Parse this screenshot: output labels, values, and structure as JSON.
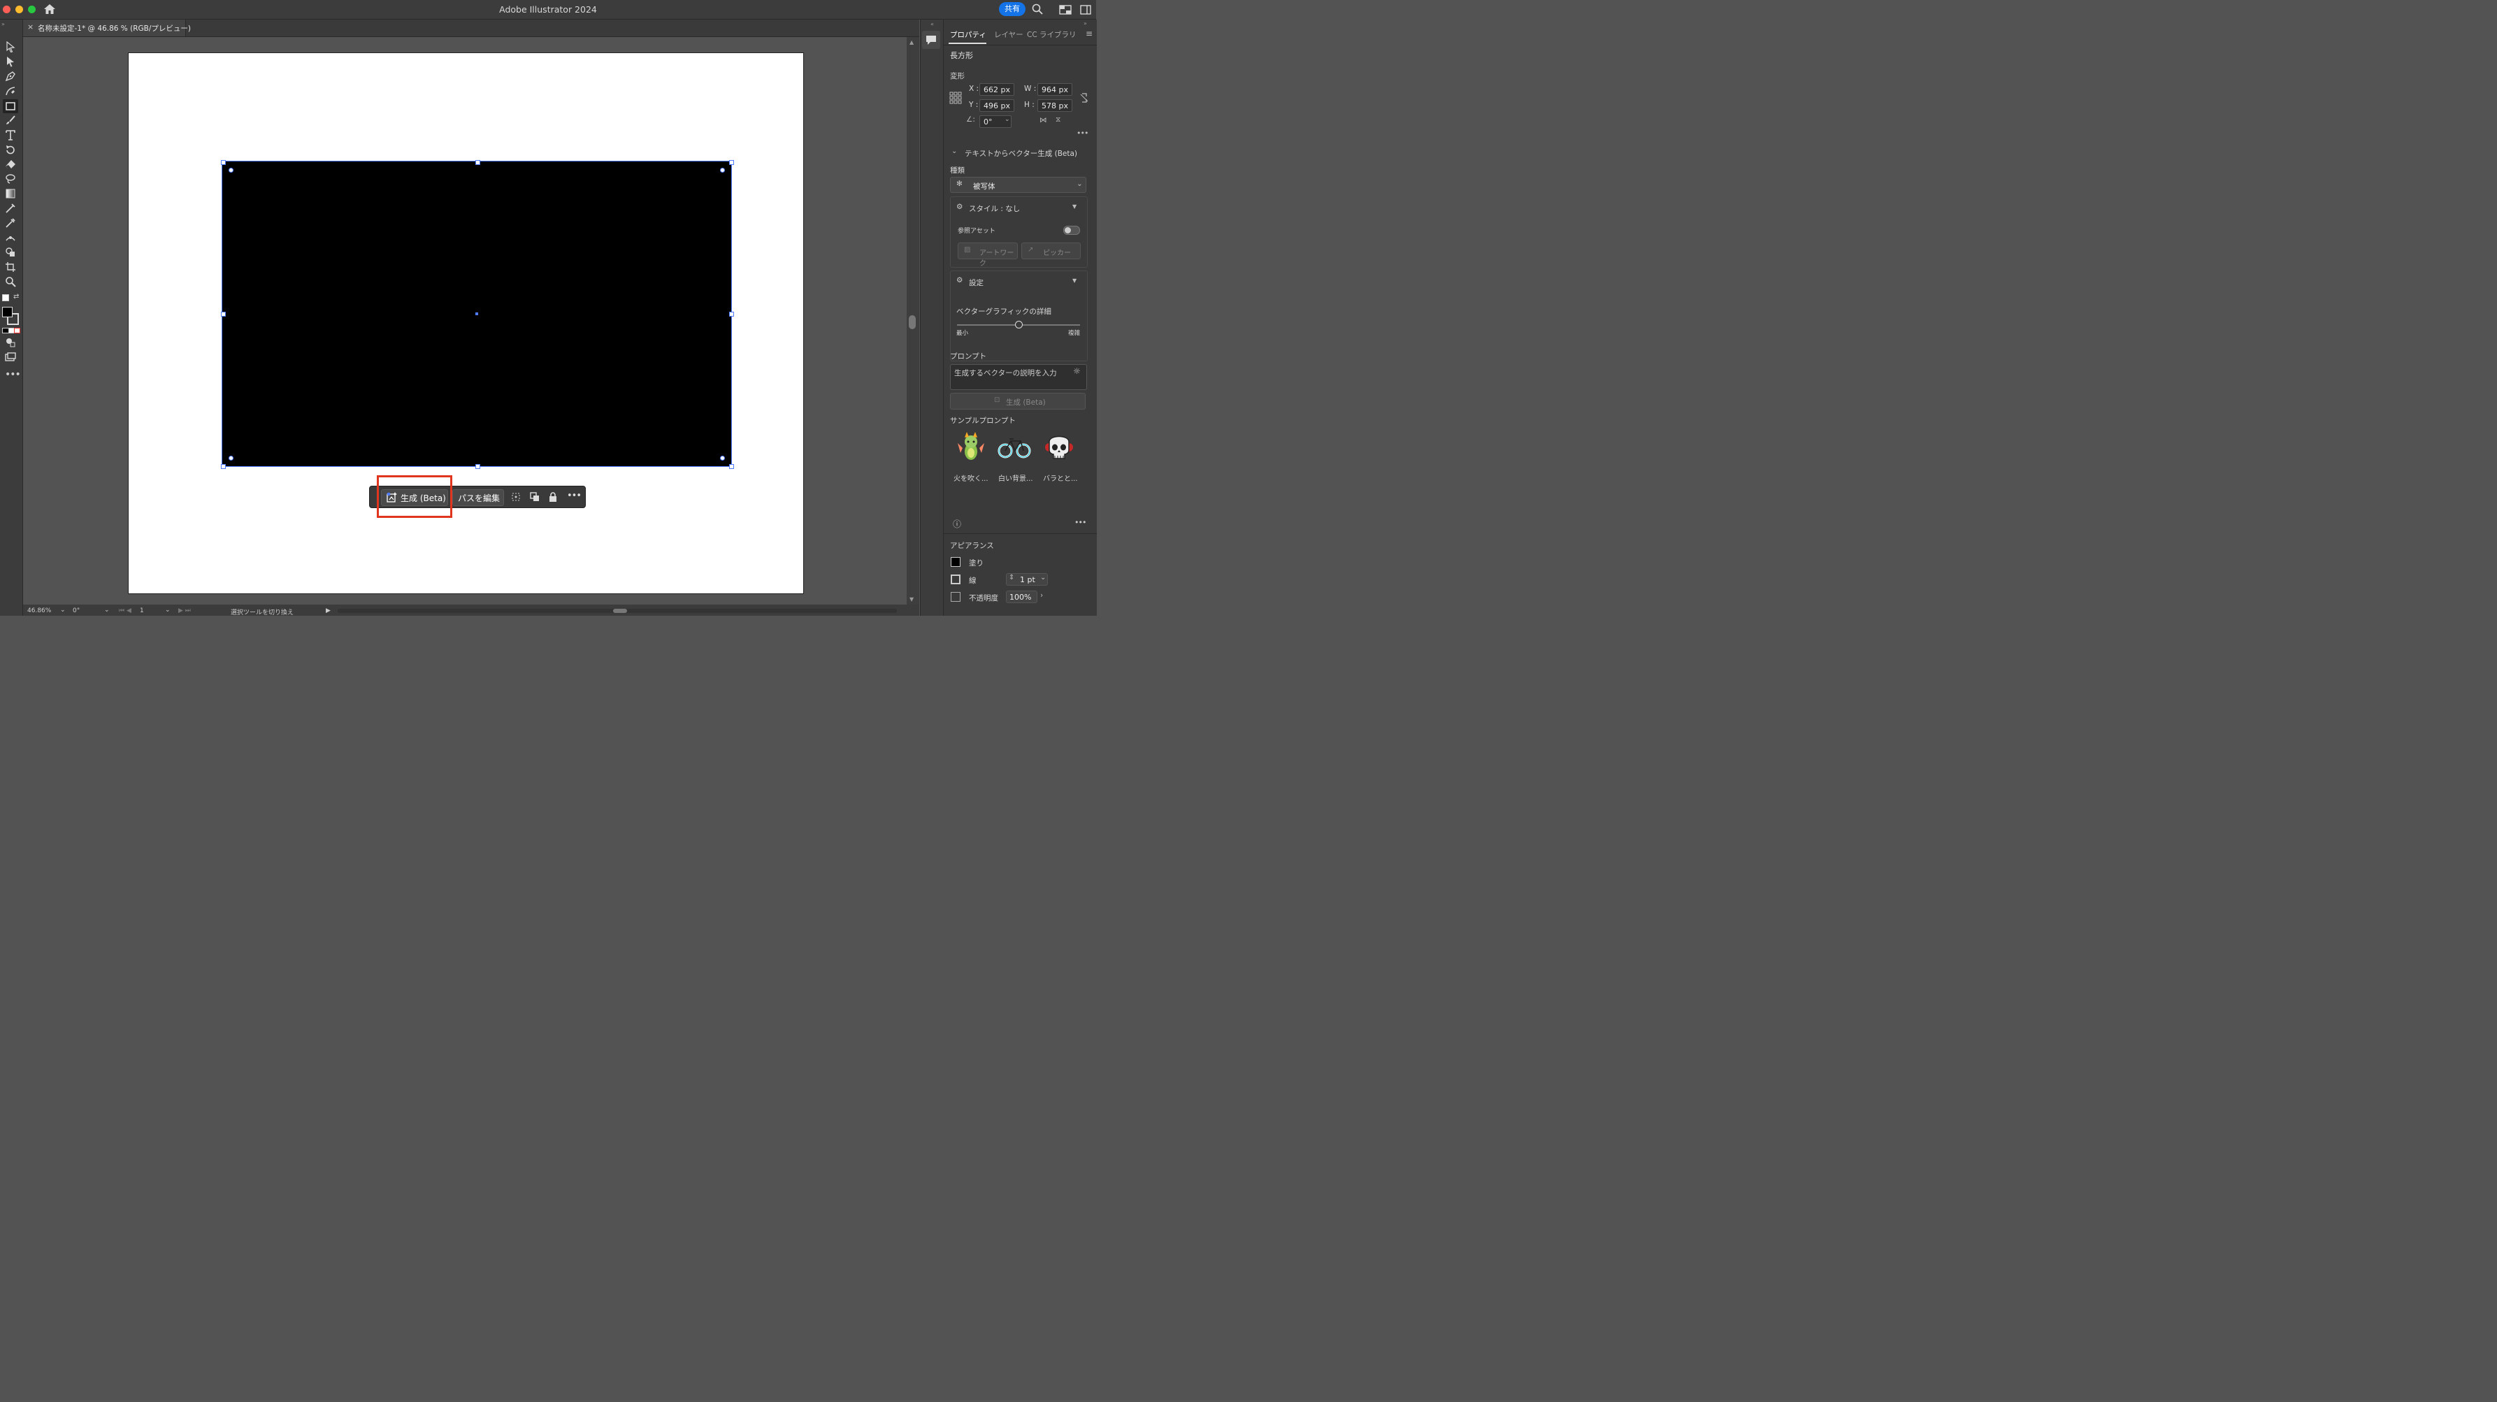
{
  "window": {
    "title": "Adobe Illustrator 2024",
    "share_label": "共有",
    "colors": {
      "close": "#ff5f57",
      "minimize": "#febc2e",
      "zoom": "#28c840",
      "accent": "#1473e6",
      "highlight": "#e0351f"
    }
  },
  "document_tab": {
    "close_glyph": "×",
    "title": "名称未設定-1* @ 46.86 % (RGB/プレビュー)"
  },
  "toolbar": {
    "tools": [
      "selection-tool",
      "direct-selection-tool",
      "pen-tool",
      "curvature-tool",
      "rectangle-tool",
      "paintbrush-tool",
      "type-tool",
      "rotate-tool",
      "eraser-tool",
      "lasso-tool",
      "gradient-tool",
      "eyedropper-tool",
      "width-tool",
      "shape-builder-tool",
      "artboard-tool",
      "zoom-tool"
    ],
    "active_tool": "rectangle-tool",
    "fill_color": "#000000"
  },
  "contextual_taskbar": {
    "generate_label": "生成 (Beta)",
    "edit_path_label": "パスを編集"
  },
  "status": {
    "zoom": "46.86%",
    "rotation": "0°",
    "artboard": "1",
    "hint": "選択ツールを切り換え"
  },
  "panel": {
    "tabs": [
      "プロパティ",
      "レイヤー",
      "CC ライブラリ"
    ],
    "object_type": "長方形",
    "transform": {
      "section": "変形",
      "x_label": "X :",
      "x": "662 px",
      "y_label": "Y :",
      "y": "496 px",
      "w_label": "W :",
      "w": "964 px",
      "h_label": "H :",
      "h": "578 px",
      "angle": "0°"
    },
    "text_to_vector": {
      "section": "テキストからベクター生成 (Beta)",
      "type_label": "種類",
      "type_value": "被写体",
      "style_label": "スタイル : なし",
      "ref_asset_label": "参照アセット",
      "artwork_label": "アートワーク",
      "picker_label": "ピッカー",
      "settings_label": "設定",
      "detail_label": "ベクターグラフィックの詳細",
      "min_label": "最小",
      "max_label": "複雑",
      "detail_level": 0.5,
      "prompt_label": "プロンプト",
      "prompt_placeholder": "生成するベクターの説明を入力",
      "generate_label": "生成 (Beta)",
      "samples_label": "サンプルプロンプト",
      "samples": [
        "火を吹く...",
        "白い背景...",
        "バラとと..."
      ]
    },
    "appearance": {
      "section": "アピアランス",
      "fill_label": "塗り",
      "stroke_label": "線",
      "stroke_weight": "1 pt",
      "opacity_label": "不透明度",
      "opacity": "100%"
    }
  }
}
